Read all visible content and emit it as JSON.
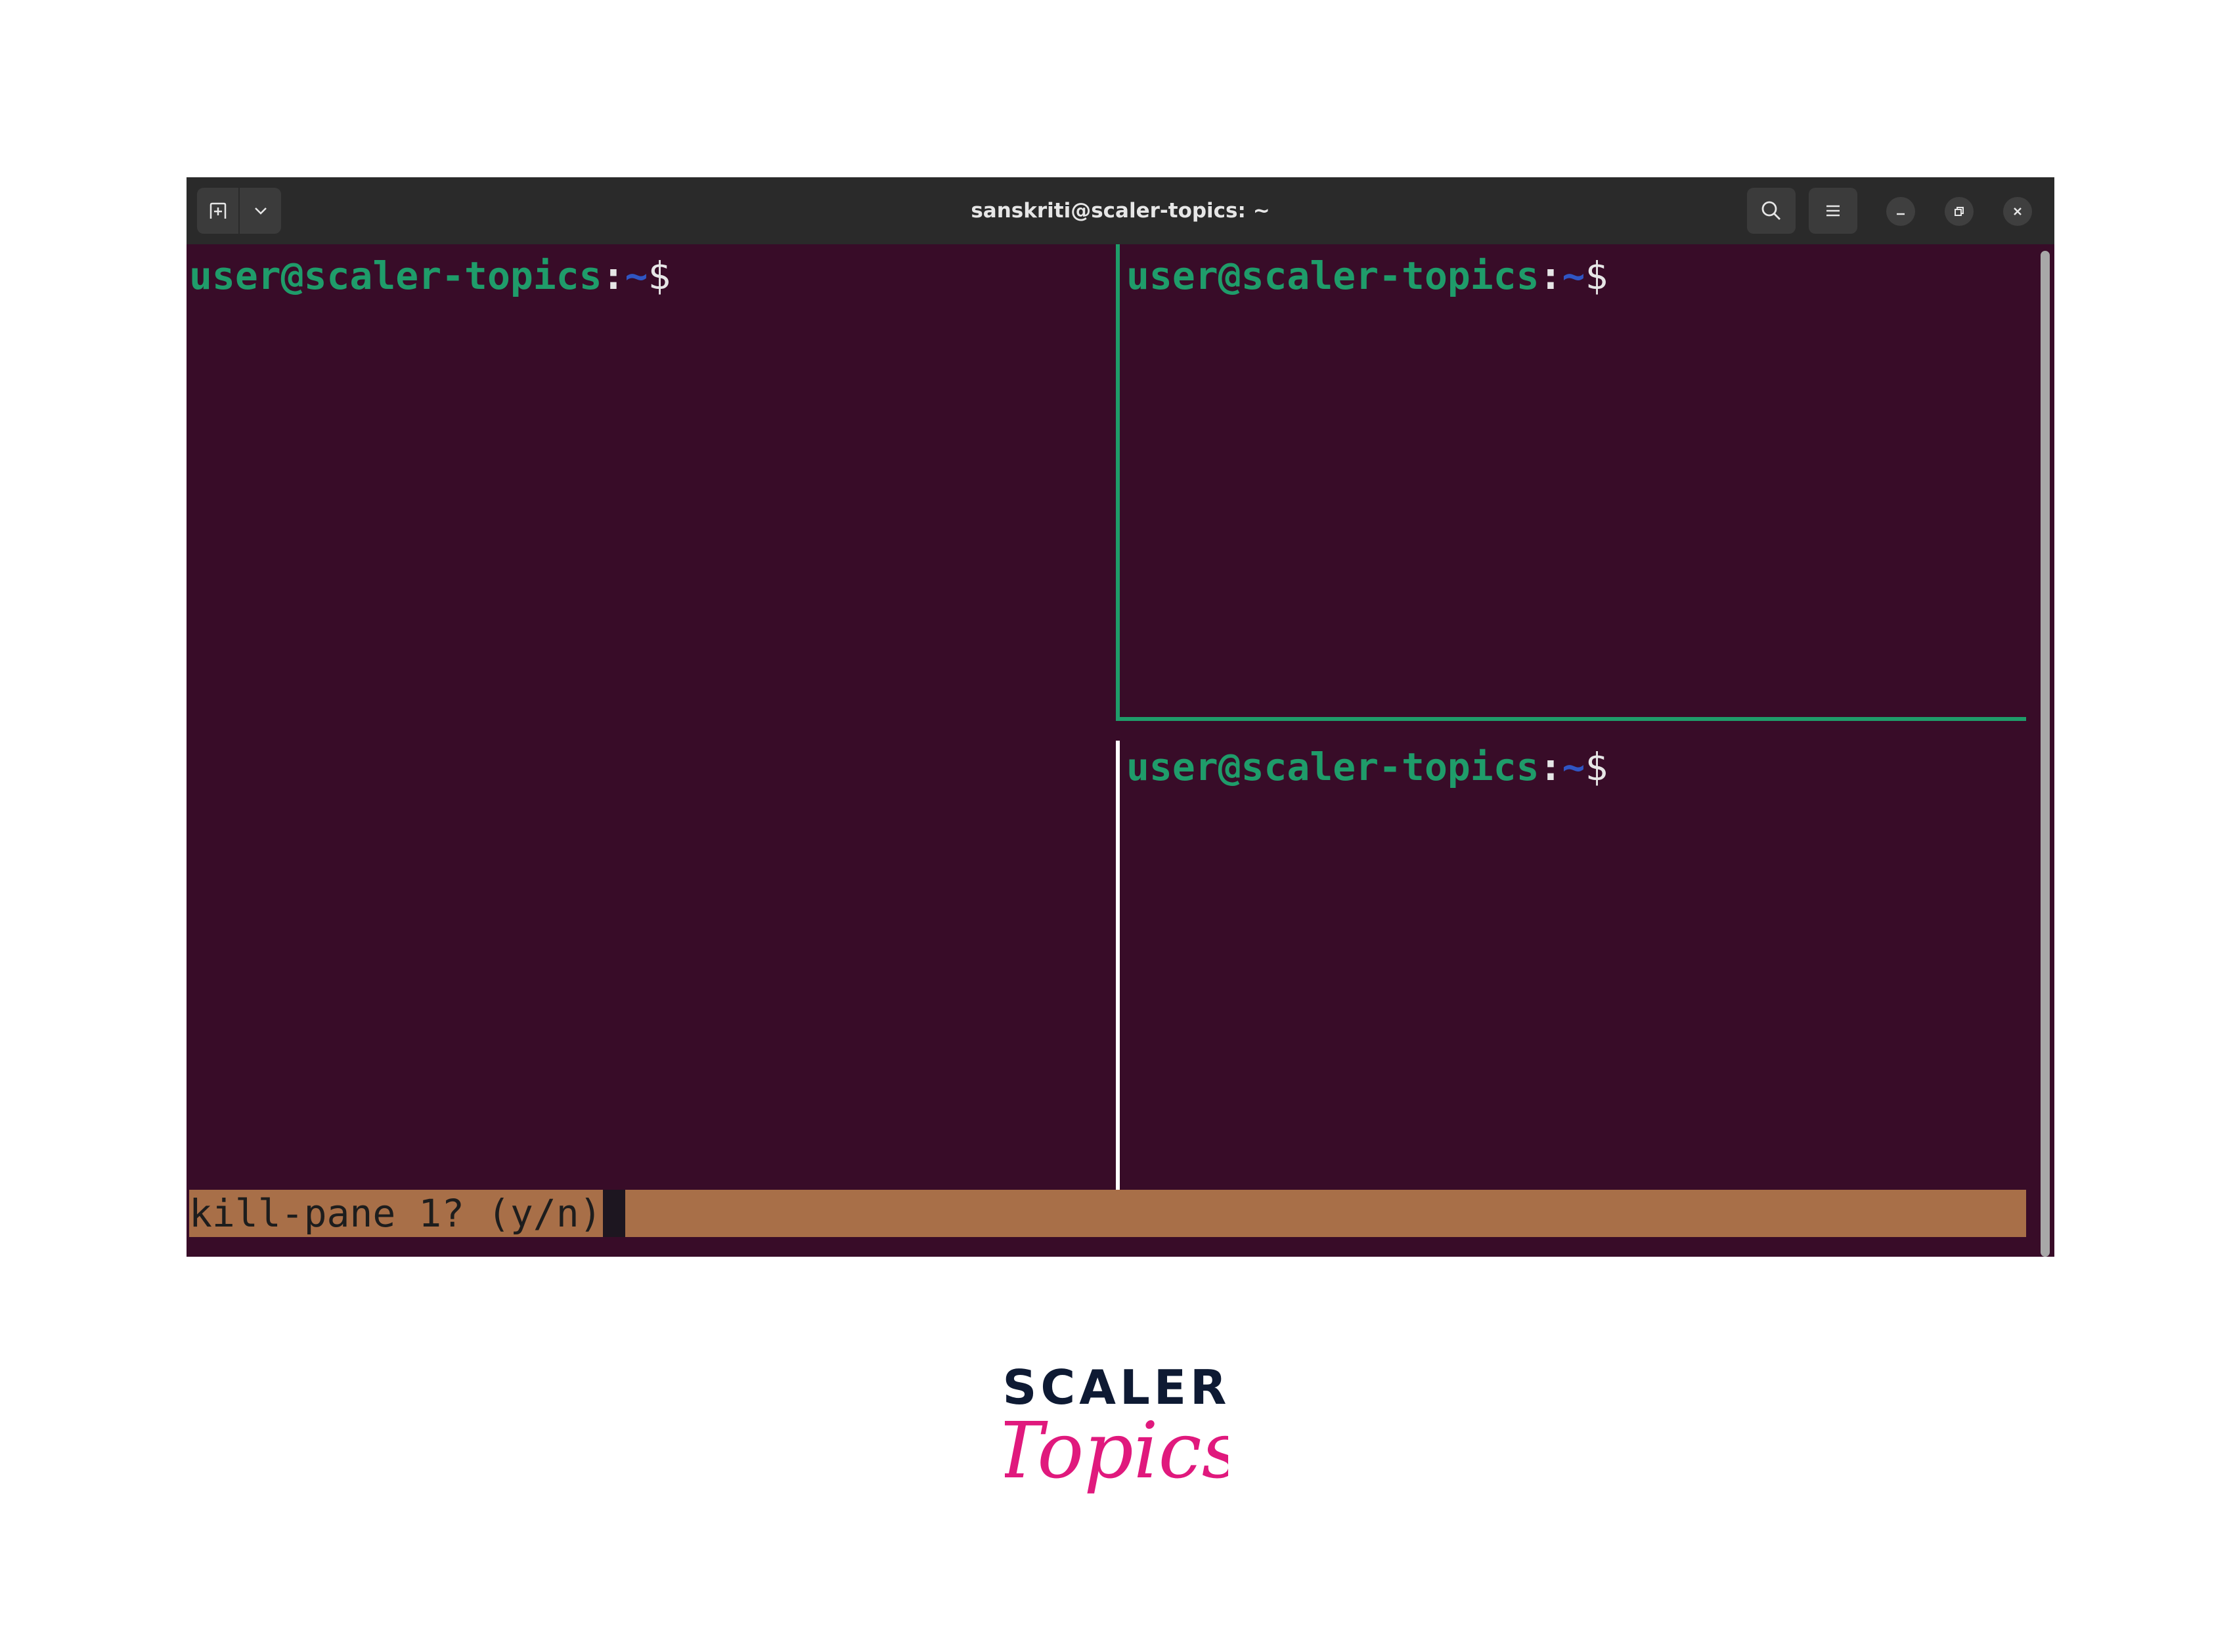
{
  "window": {
    "title": "sanskriti@scaler-topics: ~",
    "icons": [
      "new-tab-icon",
      "chevron-down-icon",
      "search-icon",
      "menu-icon",
      "minimize-icon",
      "restore-icon",
      "close-icon"
    ]
  },
  "panes": [
    {
      "user_host": "user@scaler-topics",
      "colon": ":",
      "path": "~",
      "symbol": "$"
    },
    {
      "user_host": "user@scaler-topics",
      "colon": ":",
      "path": "~",
      "symbol": "$"
    },
    {
      "user_host": "user@scaler-topics",
      "colon": ":",
      "path": "~",
      "symbol": "$"
    }
  ],
  "status": {
    "prompt": "kill-pane 1? (y/n)"
  },
  "logo": {
    "line1": "SCALER",
    "line2": "Topics"
  },
  "colors": {
    "terminal_bg": "#380c28",
    "prompt_user": "#1f9c6a",
    "prompt_path": "#2f56c3",
    "status_bar": "#a86f48",
    "active_border": "#1f9c6a",
    "logo_dark": "#0e1a33",
    "logo_pink": "#e0197d"
  }
}
